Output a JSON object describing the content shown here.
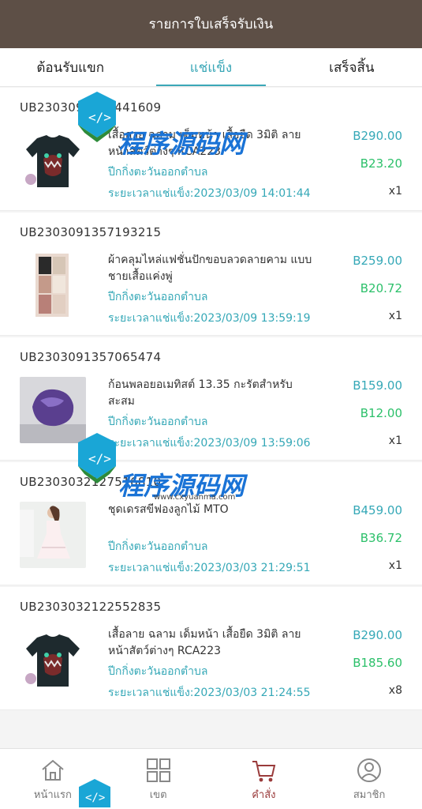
{
  "header": {
    "title": "รายการใบเสร็จรับเงิน"
  },
  "tabs": [
    {
      "label": "ต้อนรับแขก",
      "active": false
    },
    {
      "label": "แช่แข็ง",
      "active": true
    },
    {
      "label": "เสร็จสิ้น",
      "active": false
    }
  ],
  "orders": [
    {
      "id": "UB2303091401441609",
      "title": "เสื้อลาย ฉลาม เด็มหน้า เสื้อยืด 3มิติ ลาย หน้าสัตว์ต่างๆ RCA223",
      "promo": "ปีกกิ่งตะวันออกตำบล",
      "time": "ระยะเวลาแช่แข็ง:2023/03/09 14:01:44",
      "price": "B290.00",
      "commission": "B23.20",
      "qty": "x1",
      "thumb": "shirt"
    },
    {
      "id": "UB2303091357193215",
      "title": "ผ้าคลุมไหล่แฟชั่นปักขอบลวดลายคาม แบบ ชายเสื้อแค่งพู่",
      "promo": "ปีกกิ่งตะวันออกตำบล",
      "time": "ระยะเวลาแช่แข็ง:2023/03/09 13:59:19",
      "price": "B259.00",
      "commission": "B20.72",
      "qty": "x1",
      "thumb": "shawl"
    },
    {
      "id": "UB2303091357065474",
      "title": "ก้อนพลอยอเมทิสต์ 13.35 กะรัตสำหรับ สะสม",
      "promo": "ปีกกิ่งตะวันออกตำบล",
      "time": "ระยะเวลาแช่แข็ง:2023/03/09 13:59:06",
      "price": "B159.00",
      "commission": "B12.00",
      "qty": "x1",
      "thumb": "gem"
    },
    {
      "id": "UB2303032127516810",
      "title": "ชุดเดรสขีฟองลูกไม้ MTO",
      "promo": "ปีกกิ่งตะวันออกตำบล",
      "time": "ระยะเวลาแช่แข็ง:2023/03/03 21:29:51",
      "price": "B459.00",
      "commission": "B36.72",
      "qty": "x1",
      "thumb": "dress"
    },
    {
      "id": "UB2303032122552835",
      "title": "เสื้อลาย ฉลาม เด็มหน้า เสื้อยืด 3มิติ ลาย หน้าสัตว์ต่างๆ RCA223",
      "promo": "ปีกกิ่งตะวันออกตำบล",
      "time": "ระยะเวลาแช่แข็ง:2023/03/03 21:24:55",
      "price": "B290.00",
      "commission": "B185.60",
      "qty": "x8",
      "thumb": "shirt"
    }
  ],
  "nav": [
    {
      "label": "หน้าแรก",
      "icon": "home-icon",
      "active": false
    },
    {
      "label": "เขต",
      "icon": "grid-icon",
      "active": false
    },
    {
      "label": "คำสั่ง",
      "icon": "cart-icon",
      "active": true
    },
    {
      "label": "สมาชิก",
      "icon": "user-icon",
      "active": false
    }
  ],
  "watermark": {
    "text": "程序源码网",
    "url": "www.cxyuanma.com"
  },
  "colors": {
    "header": "#5d4f46",
    "accent": "#3aa7b7",
    "commission": "#2cc06a",
    "nav_active": "#9a3b3b"
  }
}
